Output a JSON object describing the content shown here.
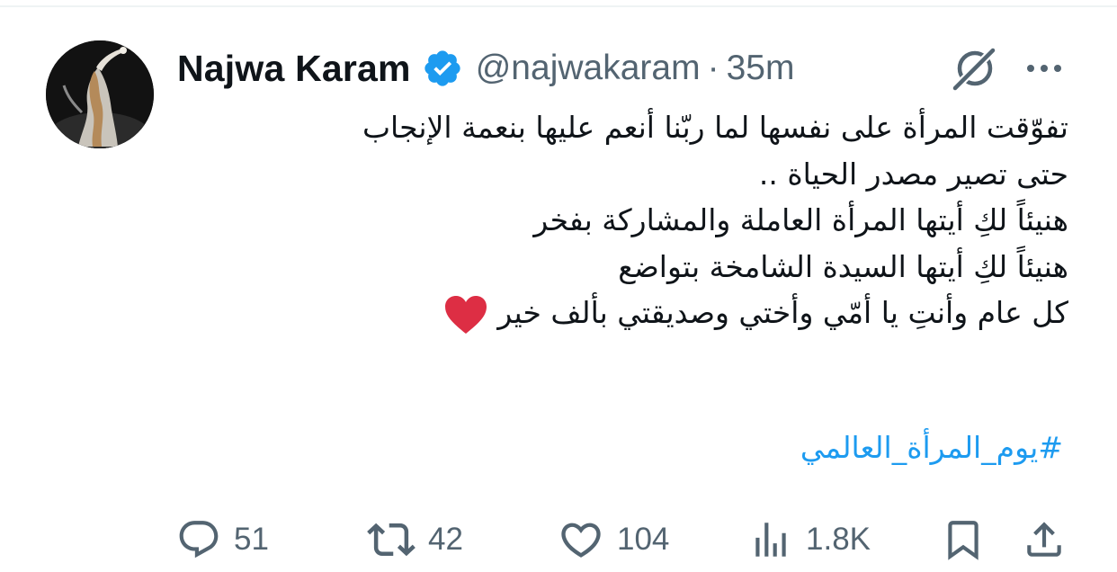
{
  "tweet": {
    "author_name": "Najwa Karam",
    "handle": "@najwakaram",
    "separator": "·",
    "time": "35m",
    "body_lines": [
      "تفوّقت المرأة على نفسها لما ربّنا أنعم عليها بنعمة الإنجاب",
      "حتى تصير مصدر الحياة ..",
      "هنيئاً لكِ أيتها المرأة العاملة والمشاركة بفخر",
      "هنيئاً لكِ أيتها السيدة الشامخة بتواضع",
      "كل عام وأنتِ يا أمّي وأختي وصديقتي بألف خير"
    ],
    "hashtag": "#يوم_المرأة_العالمي"
  },
  "actions": {
    "replies": "51",
    "reposts": "42",
    "likes": "104",
    "views": "1.8K"
  },
  "colors": {
    "accent": "#1d9bf0",
    "verified_badge": "#1d9bf0",
    "heart": "#dd2e44",
    "secondary_text": "#536471"
  },
  "icons": [
    "verified-badge-icon",
    "grok-icon",
    "more-icon",
    "reply-icon",
    "repost-icon",
    "like-icon",
    "views-icon",
    "bookmark-icon",
    "share-icon",
    "red-heart-emoji"
  ]
}
